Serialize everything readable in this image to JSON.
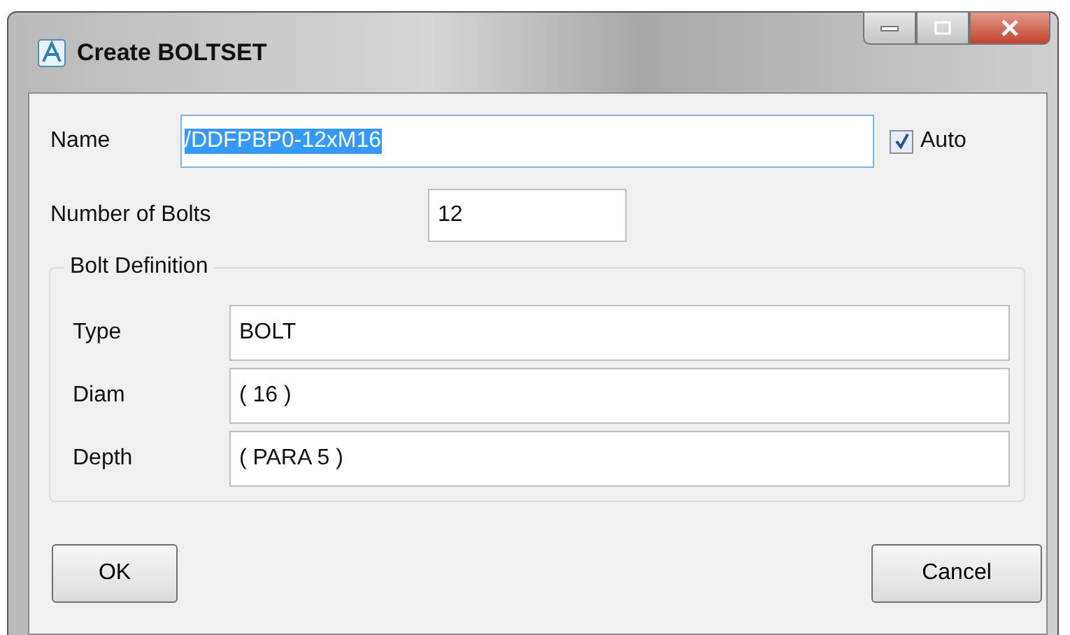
{
  "window": {
    "title": "Create BOLTSET"
  },
  "name": {
    "label": "Name",
    "value": "/DDFPBP0-12xM16",
    "text_selected": true
  },
  "auto": {
    "label": "Auto",
    "checked": true
  },
  "number_of_bolts": {
    "label": "Number of Bolts",
    "value": "12"
  },
  "bolt_definition": {
    "title": "Bolt Definition",
    "fields": [
      {
        "label": "Type",
        "value": "BOLT"
      },
      {
        "label": "Diam",
        "value": "( 16 )"
      },
      {
        "label": "Depth",
        "value": "( PARA 5 )"
      }
    ]
  },
  "buttons": [
    {
      "label": "OK",
      "kind": "ok"
    },
    {
      "label": "Cancel",
      "kind": "cancel"
    }
  ]
}
